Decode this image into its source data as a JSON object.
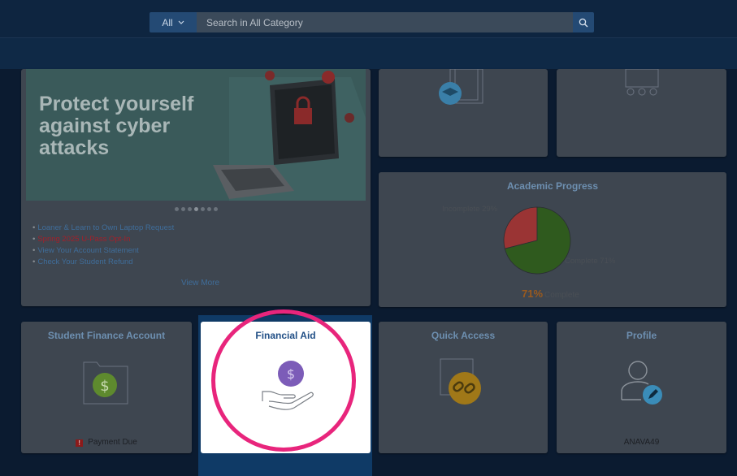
{
  "search": {
    "category": "All",
    "placeholder": "Search in All Category"
  },
  "banner": {
    "headline": "Protect yourself against cyber attacks",
    "links": [
      {
        "label": "Loaner & Learn to Own Laptop Request",
        "style": "normal"
      },
      {
        "label": "Spring 2025 U-Pass Opt-In",
        "style": "alert"
      },
      {
        "label": "View Your Account Statement",
        "style": "normal"
      },
      {
        "label": "Check Your Student Refund",
        "style": "normal"
      }
    ],
    "view_more": "View More"
  },
  "academic_progress": {
    "title": "Academic Progress",
    "incomplete_label": "Incomplete 29%",
    "complete_label": "Complete 71%",
    "percent": "71%",
    "percent_suffix": "Complete"
  },
  "chart_data": {
    "type": "pie",
    "title": "Academic Progress",
    "categories": [
      "Incomplete",
      "Complete"
    ],
    "values": [
      29,
      71
    ],
    "colors": [
      "#9a3434",
      "#2f5a1e"
    ]
  },
  "tiles": {
    "student_finance": {
      "title": "Student Finance Account",
      "footer": "Payment Due",
      "alert_glyph": "!"
    },
    "financial_aid": {
      "title": "Financial Aid"
    },
    "quick_access": {
      "title": "Quick Access"
    },
    "profile": {
      "title": "Profile",
      "footer": "ANAVA49"
    }
  },
  "colors": {
    "accent": "#214f86",
    "highlight": "#e8257c",
    "alert": "#8b1a1a"
  }
}
